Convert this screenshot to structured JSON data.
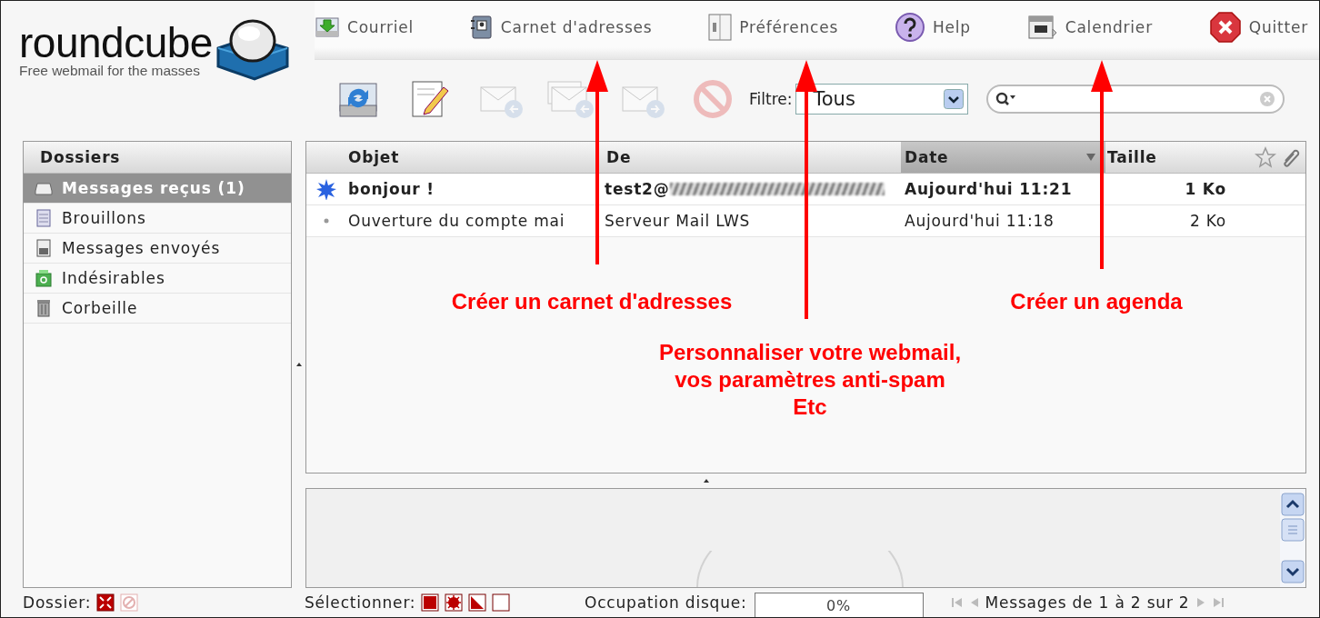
{
  "header": {
    "logo": {
      "name": "roundcube",
      "tagline": "Free webmail for the masses"
    },
    "nav": [
      {
        "label": "Courriel",
        "kind": "mail"
      },
      {
        "label": "Carnet d'adresses",
        "kind": "contacts"
      },
      {
        "label": "Préférences",
        "kind": "settings"
      },
      {
        "label": "Help",
        "kind": "help"
      },
      {
        "label": "Calendrier",
        "kind": "calendar"
      },
      {
        "label": "Quitter",
        "kind": "logout"
      }
    ]
  },
  "toolbar": {
    "buttons": [
      {
        "kind": "refresh",
        "disabled": false
      },
      {
        "kind": "compose",
        "disabled": false
      },
      {
        "kind": "reply",
        "disabled": true
      },
      {
        "kind": "reply-all",
        "disabled": true
      },
      {
        "kind": "forward",
        "disabled": true
      },
      {
        "kind": "delete",
        "disabled": true
      }
    ],
    "filter": {
      "label": "Filtre:",
      "value": "Tous"
    }
  },
  "folders": {
    "title": "Dossiers",
    "items": [
      {
        "label": "Messages reçus (1)",
        "kind": "inbox",
        "selected": true
      },
      {
        "label": "Brouillons",
        "kind": "drafts",
        "selected": false
      },
      {
        "label": "Messages envoyés",
        "kind": "sent",
        "selected": false
      },
      {
        "label": "Indésirables",
        "kind": "junk",
        "selected": false
      },
      {
        "label": "Corbeille",
        "kind": "trash",
        "selected": false
      }
    ]
  },
  "messages": {
    "columns": [
      {
        "label": "Objet",
        "sorted": false
      },
      {
        "label": "De",
        "sorted": false
      },
      {
        "label": "Date",
        "sorted": true
      },
      {
        "label": "Taille",
        "sorted": false
      }
    ],
    "rows": [
      {
        "subject": "bonjour !",
        "from": "test2@",
        "redacted": true,
        "date": "Aujourd'hui 11:21",
        "size": "1 Ko",
        "unread": true
      },
      {
        "subject": "Ouverture du compte mai",
        "from": "Serveur Mail LWS",
        "redacted": false,
        "date": "Aujourd'hui 11:18",
        "size": "2 Ko",
        "unread": false
      }
    ]
  },
  "footer": {
    "folder_label": "Dossier:",
    "select_label": "Sélectionner:",
    "quota": {
      "label": "Occupation disque:",
      "reading": "0%",
      "level": 0
    },
    "pagination": "Messages de 1 à 2 sur 2"
  },
  "annotations": [
    {
      "lines": [
        "Créer un carnet d'adresses"
      ]
    },
    {
      "lines": [
        "Personnaliser votre webmail,",
        "vos paramètres anti-spam",
        "Etc"
      ]
    },
    {
      "lines": [
        "Créer un agenda"
      ]
    }
  ]
}
